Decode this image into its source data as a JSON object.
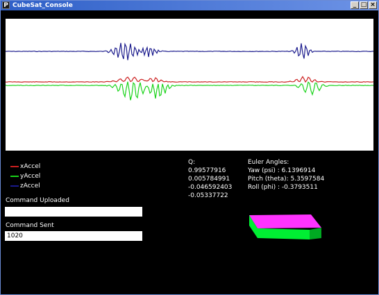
{
  "window": {
    "title": "CubeSat_Console",
    "app_icon": "P",
    "minimize": "_",
    "maximize": "□",
    "close": "×"
  },
  "colors": {
    "xAccel": "#cc2020",
    "yAccel": "#19d319",
    "zAccel": "#1a1a8c",
    "cube_top": "#ff33ff",
    "cube_side": "#00ee33",
    "cube_right": "#00aa22"
  },
  "legend": [
    {
      "label": "xAccel",
      "color": "#cc2020"
    },
    {
      "label": "yAccel",
      "color": "#19d319"
    },
    {
      "label": "zAccel",
      "color": "#1a1a8c"
    }
  ],
  "command_uploaded": {
    "label": "Command Uploaded",
    "value": ""
  },
  "command_sent": {
    "label": "Command Sent",
    "value": "1020"
  },
  "quaternion": {
    "title": "Q:",
    "values": [
      "0.99577916",
      "0.005784991",
      "-0.046592403",
      "-0.05337722"
    ]
  },
  "euler": {
    "title": "Euler Angles:",
    "yaw": "Yaw (psi)  : 6.1396914",
    "pitch": "Pitch (theta): 5.3597584",
    "roll": "Roll (phi)  : -0.3793511"
  }
}
